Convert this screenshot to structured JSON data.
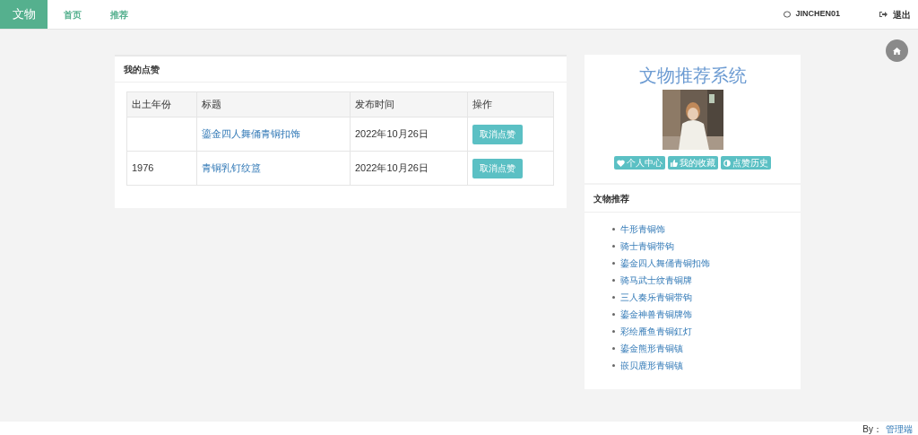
{
  "navbar": {
    "brand": "文物",
    "links": [
      {
        "label": "首页",
        "selected": false
      },
      {
        "label": "推荐",
        "selected": false
      }
    ],
    "user": "JINCHEN01",
    "logout": "退出"
  },
  "likes_panel": {
    "title": "我的点赞",
    "table": {
      "columns": [
        "出土年份",
        "标题",
        "发布时间",
        "操作"
      ],
      "rows": [
        {
          "year": "",
          "title": "鎏金四人舞俑青铜扣饰",
          "date": "2022年10月26日",
          "action": "取消点赞"
        },
        {
          "year": "1976",
          "title": "青铜乳钉纹簋",
          "date": "2022年10月26日",
          "action": "取消点赞"
        }
      ]
    }
  },
  "profile": {
    "heading": "文物推荐系统",
    "buttons": [
      {
        "kind": "heart",
        "label": "个人中心"
      },
      {
        "kind": "thumb",
        "label": "我的收藏"
      },
      {
        "kind": "half",
        "label": "点赞历史"
      }
    ]
  },
  "recommend": {
    "title": "文物推荐",
    "items": [
      "牛形青铜饰",
      "骑士青铜带钩",
      "鎏金四人舞俑青铜扣饰",
      "骑马武士纹青铜牌",
      "三人奏乐青铜带钩",
      "鎏金神兽青铜牌饰",
      "彩绘雁鱼青铜釭灯",
      "鎏金熊形青铜镇",
      "嵌贝鹿形青铜镇"
    ]
  },
  "footer": {
    "by": "By：",
    "link": "管理端"
  }
}
